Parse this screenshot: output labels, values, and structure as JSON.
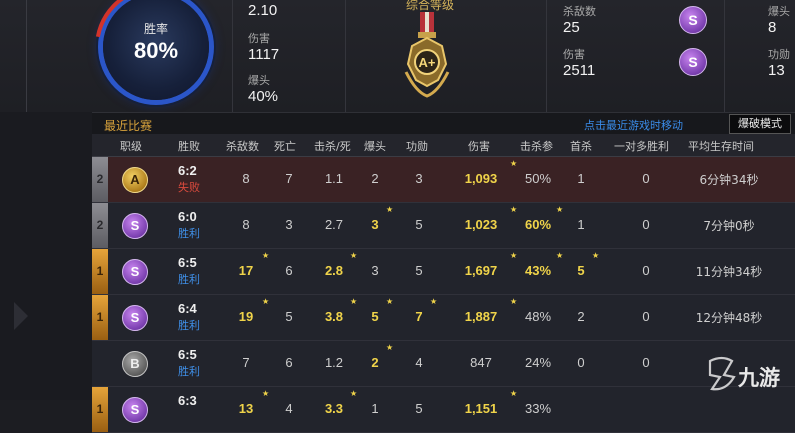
{
  "summary": {
    "win_rate_label": "胜率",
    "win_rate_value": "80%",
    "kd_value": "2.10",
    "damage_label": "伤害",
    "damage_value": "1117",
    "headshot_label": "爆头",
    "headshot_value": "40%",
    "overall_level_label": "综合等级",
    "overall_level_badge": "A+",
    "right": {
      "kills_label": "杀敌数",
      "kills_value": "25",
      "damage_label": "伤害",
      "damage_value": "2511",
      "badge_top": "S",
      "badge_bottom": "S",
      "headshot_label": "爆头",
      "headshot_value": "8",
      "merit_label": "功勋",
      "merit_value": "13"
    }
  },
  "recent": {
    "title": "最近比赛",
    "link": "点击最近游戏时移动",
    "mode_selected": "爆破模式"
  },
  "table": {
    "headers": [
      "职级",
      "胜败",
      "杀敌数",
      "死亡",
      "击杀/死",
      "爆头",
      "功勋",
      "伤害",
      "击杀参",
      "首杀",
      "一对多胜利",
      "平均生存时间"
    ],
    "rows": [
      {
        "rank": "2",
        "rank_color": "silver",
        "level": "A",
        "score": "6:2",
        "result": "失败",
        "outcome": "loss",
        "kills": "8",
        "deaths": "7",
        "kd": "1.1",
        "hs": "2",
        "merit": "3",
        "damage": "1,093",
        "part": "50%",
        "first": "1",
        "clutch": "0",
        "survive": "6分钟34秒",
        "hl": {
          "kills": false,
          "kd": false,
          "hs": false,
          "merit": false,
          "damage": true,
          "part": false,
          "first": false
        },
        "stars": {
          "kills": false,
          "kd": false,
          "hs": false,
          "merit": false,
          "damage": true,
          "part": false,
          "first": false
        }
      },
      {
        "rank": "2",
        "rank_color": "silver",
        "level": "S",
        "score": "6:0",
        "result": "胜利",
        "outcome": "win",
        "kills": "8",
        "deaths": "3",
        "kd": "2.7",
        "hs": "3",
        "merit": "5",
        "damage": "1,023",
        "part": "60%",
        "first": "1",
        "clutch": "0",
        "survive": "7分钟0秒",
        "hl": {
          "kills": false,
          "kd": false,
          "hs": true,
          "merit": false,
          "damage": true,
          "part": true,
          "first": false
        },
        "stars": {
          "kills": false,
          "kd": false,
          "hs": true,
          "merit": false,
          "damage": true,
          "part": true,
          "first": false
        }
      },
      {
        "rank": "1",
        "rank_color": "gold",
        "level": "S",
        "score": "6:5",
        "result": "胜利",
        "outcome": "win",
        "kills": "17",
        "deaths": "6",
        "kd": "2.8",
        "hs": "3",
        "merit": "5",
        "damage": "1,697",
        "part": "43%",
        "first": "5",
        "clutch": "0",
        "survive": "11分钟34秒",
        "hl": {
          "kills": true,
          "kd": true,
          "hs": false,
          "merit": false,
          "damage": true,
          "part": true,
          "first": true
        },
        "stars": {
          "kills": true,
          "kd": true,
          "hs": false,
          "merit": false,
          "damage": true,
          "part": true,
          "first": true
        }
      },
      {
        "rank": "1",
        "rank_color": "gold",
        "level": "S",
        "score": "6:4",
        "result": "胜利",
        "outcome": "win",
        "kills": "19",
        "deaths": "5",
        "kd": "3.8",
        "hs": "5",
        "merit": "7",
        "damage": "1,887",
        "part": "48%",
        "first": "2",
        "clutch": "0",
        "survive": "12分钟48秒",
        "hl": {
          "kills": true,
          "kd": true,
          "hs": true,
          "merit": true,
          "damage": true,
          "part": false,
          "first": false
        },
        "stars": {
          "kills": true,
          "kd": true,
          "hs": true,
          "merit": true,
          "damage": true,
          "part": false,
          "first": false
        }
      },
      {
        "rank": "",
        "rank_color": "none",
        "level": "B",
        "score": "6:5",
        "result": "胜利",
        "outcome": "win",
        "kills": "7",
        "deaths": "6",
        "kd": "1.2",
        "hs": "2",
        "merit": "4",
        "damage": "847",
        "part": "24%",
        "first": "0",
        "clutch": "0",
        "survive": "",
        "hl": {
          "kills": false,
          "kd": false,
          "hs": true,
          "merit": false,
          "damage": false,
          "part": false,
          "first": false
        },
        "stars": {
          "kills": false,
          "kd": false,
          "hs": true,
          "merit": false,
          "damage": false,
          "part": false,
          "first": false
        }
      },
      {
        "rank": "1",
        "rank_color": "gold",
        "level": "S",
        "score": "6:3",
        "result": "",
        "outcome": "win",
        "kills": "13",
        "deaths": "4",
        "kd": "3.3",
        "hs": "1",
        "merit": "5",
        "damage": "1,151",
        "part": "33%",
        "first": "",
        "clutch": "",
        "survive": "",
        "hl": {
          "kills": true,
          "kd": true,
          "hs": false,
          "merit": false,
          "damage": true,
          "part": false,
          "first": false
        },
        "stars": {
          "kills": true,
          "kd": true,
          "hs": false,
          "merit": false,
          "damage": true,
          "part": false,
          "first": false
        }
      }
    ]
  },
  "watermark": "九游"
}
